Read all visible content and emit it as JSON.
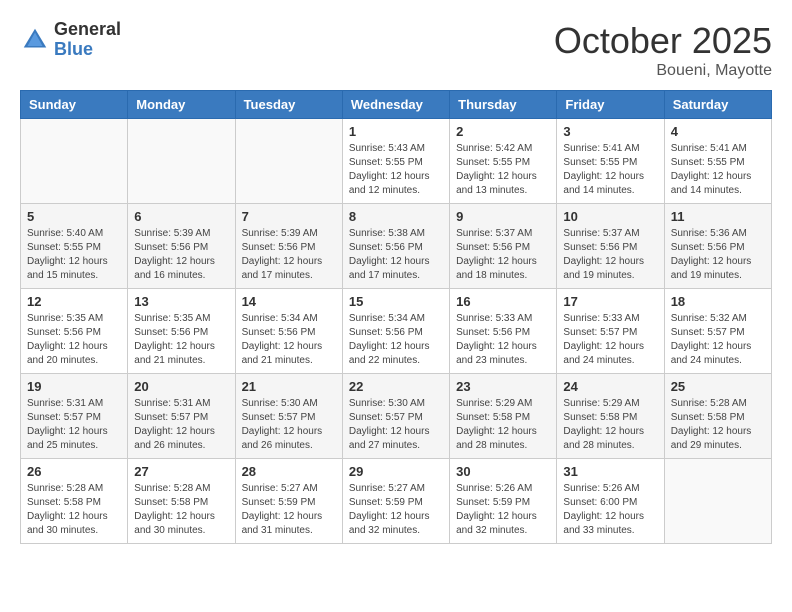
{
  "logo": {
    "general": "General",
    "blue": "Blue"
  },
  "title": "October 2025",
  "subtitle": "Boueni, Mayotte",
  "weekdays": [
    "Sunday",
    "Monday",
    "Tuesday",
    "Wednesday",
    "Thursday",
    "Friday",
    "Saturday"
  ],
  "weeks": [
    [
      {
        "day": "",
        "info": ""
      },
      {
        "day": "",
        "info": ""
      },
      {
        "day": "",
        "info": ""
      },
      {
        "day": "1",
        "info": "Sunrise: 5:43 AM\nSunset: 5:55 PM\nDaylight: 12 hours\nand 12 minutes."
      },
      {
        "day": "2",
        "info": "Sunrise: 5:42 AM\nSunset: 5:55 PM\nDaylight: 12 hours\nand 13 minutes."
      },
      {
        "day": "3",
        "info": "Sunrise: 5:41 AM\nSunset: 5:55 PM\nDaylight: 12 hours\nand 14 minutes."
      },
      {
        "day": "4",
        "info": "Sunrise: 5:41 AM\nSunset: 5:55 PM\nDaylight: 12 hours\nand 14 minutes."
      }
    ],
    [
      {
        "day": "5",
        "info": "Sunrise: 5:40 AM\nSunset: 5:55 PM\nDaylight: 12 hours\nand 15 minutes."
      },
      {
        "day": "6",
        "info": "Sunrise: 5:39 AM\nSunset: 5:56 PM\nDaylight: 12 hours\nand 16 minutes."
      },
      {
        "day": "7",
        "info": "Sunrise: 5:39 AM\nSunset: 5:56 PM\nDaylight: 12 hours\nand 17 minutes."
      },
      {
        "day": "8",
        "info": "Sunrise: 5:38 AM\nSunset: 5:56 PM\nDaylight: 12 hours\nand 17 minutes."
      },
      {
        "day": "9",
        "info": "Sunrise: 5:37 AM\nSunset: 5:56 PM\nDaylight: 12 hours\nand 18 minutes."
      },
      {
        "day": "10",
        "info": "Sunrise: 5:37 AM\nSunset: 5:56 PM\nDaylight: 12 hours\nand 19 minutes."
      },
      {
        "day": "11",
        "info": "Sunrise: 5:36 AM\nSunset: 5:56 PM\nDaylight: 12 hours\nand 19 minutes."
      }
    ],
    [
      {
        "day": "12",
        "info": "Sunrise: 5:35 AM\nSunset: 5:56 PM\nDaylight: 12 hours\nand 20 minutes."
      },
      {
        "day": "13",
        "info": "Sunrise: 5:35 AM\nSunset: 5:56 PM\nDaylight: 12 hours\nand 21 minutes."
      },
      {
        "day": "14",
        "info": "Sunrise: 5:34 AM\nSunset: 5:56 PM\nDaylight: 12 hours\nand 21 minutes."
      },
      {
        "day": "15",
        "info": "Sunrise: 5:34 AM\nSunset: 5:56 PM\nDaylight: 12 hours\nand 22 minutes."
      },
      {
        "day": "16",
        "info": "Sunrise: 5:33 AM\nSunset: 5:56 PM\nDaylight: 12 hours\nand 23 minutes."
      },
      {
        "day": "17",
        "info": "Sunrise: 5:33 AM\nSunset: 5:57 PM\nDaylight: 12 hours\nand 24 minutes."
      },
      {
        "day": "18",
        "info": "Sunrise: 5:32 AM\nSunset: 5:57 PM\nDaylight: 12 hours\nand 24 minutes."
      }
    ],
    [
      {
        "day": "19",
        "info": "Sunrise: 5:31 AM\nSunset: 5:57 PM\nDaylight: 12 hours\nand 25 minutes."
      },
      {
        "day": "20",
        "info": "Sunrise: 5:31 AM\nSunset: 5:57 PM\nDaylight: 12 hours\nand 26 minutes."
      },
      {
        "day": "21",
        "info": "Sunrise: 5:30 AM\nSunset: 5:57 PM\nDaylight: 12 hours\nand 26 minutes."
      },
      {
        "day": "22",
        "info": "Sunrise: 5:30 AM\nSunset: 5:57 PM\nDaylight: 12 hours\nand 27 minutes."
      },
      {
        "day": "23",
        "info": "Sunrise: 5:29 AM\nSunset: 5:58 PM\nDaylight: 12 hours\nand 28 minutes."
      },
      {
        "day": "24",
        "info": "Sunrise: 5:29 AM\nSunset: 5:58 PM\nDaylight: 12 hours\nand 28 minutes."
      },
      {
        "day": "25",
        "info": "Sunrise: 5:28 AM\nSunset: 5:58 PM\nDaylight: 12 hours\nand 29 minutes."
      }
    ],
    [
      {
        "day": "26",
        "info": "Sunrise: 5:28 AM\nSunset: 5:58 PM\nDaylight: 12 hours\nand 30 minutes."
      },
      {
        "day": "27",
        "info": "Sunrise: 5:28 AM\nSunset: 5:58 PM\nDaylight: 12 hours\nand 30 minutes."
      },
      {
        "day": "28",
        "info": "Sunrise: 5:27 AM\nSunset: 5:59 PM\nDaylight: 12 hours\nand 31 minutes."
      },
      {
        "day": "29",
        "info": "Sunrise: 5:27 AM\nSunset: 5:59 PM\nDaylight: 12 hours\nand 32 minutes."
      },
      {
        "day": "30",
        "info": "Sunrise: 5:26 AM\nSunset: 5:59 PM\nDaylight: 12 hours\nand 32 minutes."
      },
      {
        "day": "31",
        "info": "Sunrise: 5:26 AM\nSunset: 6:00 PM\nDaylight: 12 hours\nand 33 minutes."
      },
      {
        "day": "",
        "info": ""
      }
    ]
  ]
}
